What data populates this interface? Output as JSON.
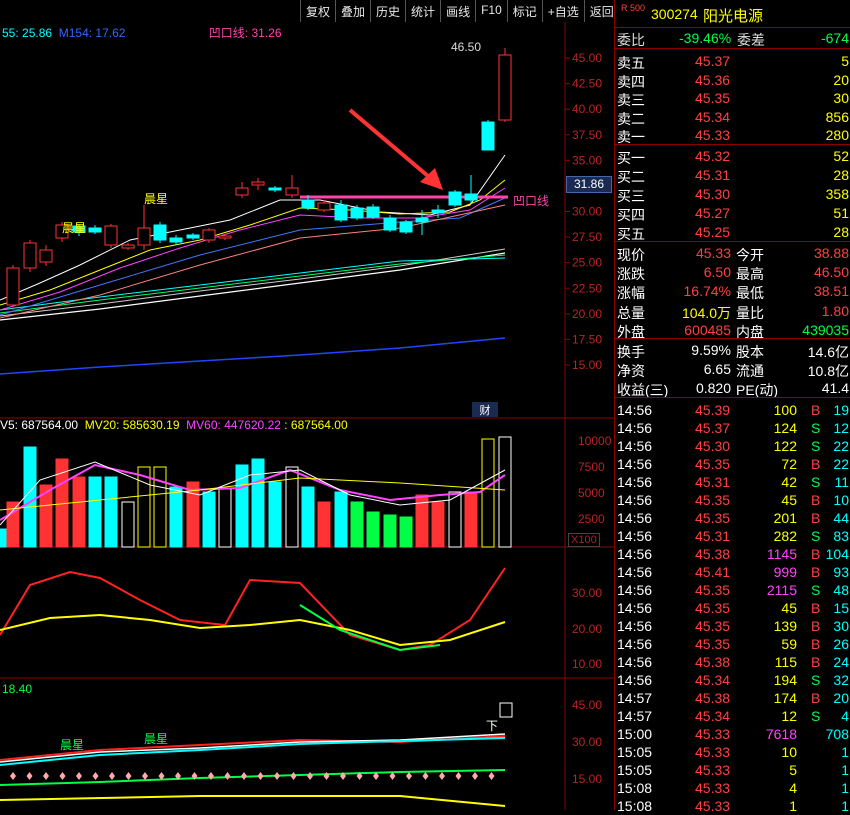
{
  "toolbar": [
    "复权",
    "叠加",
    "历史",
    "统计",
    "画线",
    "F10",
    "标记",
    "+自选",
    "返回"
  ],
  "ma_legend": {
    "ma55": "55: 25.86",
    "ma154": "M154: 17.62",
    "aokou": "凹口线: 31.26"
  },
  "price_axis": [
    "45.00",
    "42.50",
    "40.00",
    "37.50",
    "35.00",
    "32.50",
    "30.00",
    "27.50",
    "25.00",
    "22.50",
    "20.00",
    "17.50",
    "15.00"
  ],
  "current_price_tag": "31.86",
  "max_label": "46.50",
  "pattern_labels": {
    "chenxing": "晨星",
    "aokou_line": "凹口线",
    "cai": "财"
  },
  "volume_legend": {
    "v5": "V5: 687564.00",
    "mv20": "MV20: 585630.19",
    "mv60": "MV60: 447620.22",
    "v": ": 687564.00"
  },
  "volume_axis": [
    "10000",
    "7500",
    "5000",
    "2500"
  ],
  "volume_scale": "X100",
  "ind2_axis": [
    "30.00",
    "20.00",
    "10.00"
  ],
  "ind3_legend": "18.40",
  "ind3_axis": [
    "45.00",
    "30.00",
    "15.00"
  ],
  "ind3_labels": {
    "chenxing": "晨星",
    "xia": "下"
  },
  "stock": {
    "index_tag": "R 500",
    "code": "300274",
    "name": "阳光电源"
  },
  "weibi": {
    "label": "委比",
    "value": "-39.46%",
    "label2": "委差",
    "value2": "-674"
  },
  "asks": [
    {
      "label": "卖五",
      "price": "45.37",
      "vol": "5"
    },
    {
      "label": "卖四",
      "price": "45.36",
      "vol": "20"
    },
    {
      "label": "卖三",
      "price": "45.35",
      "vol": "30"
    },
    {
      "label": "卖二",
      "price": "45.34",
      "vol": "856"
    },
    {
      "label": "卖一",
      "price": "45.33",
      "vol": "280"
    }
  ],
  "bids": [
    {
      "label": "买一",
      "price": "45.32",
      "vol": "52"
    },
    {
      "label": "买二",
      "price": "45.31",
      "vol": "28"
    },
    {
      "label": "买三",
      "price": "45.30",
      "vol": "358"
    },
    {
      "label": "买四",
      "price": "45.27",
      "vol": "51"
    },
    {
      "label": "买五",
      "price": "45.25",
      "vol": "28"
    }
  ],
  "stats": [
    {
      "l1": "现价",
      "v1": "45.33",
      "l2": "今开",
      "v2": "38.88",
      "c1": "red",
      "c2": "red"
    },
    {
      "l1": "涨跌",
      "v1": "6.50",
      "l2": "最高",
      "v2": "46.50",
      "c1": "red",
      "c2": "red"
    },
    {
      "l1": "涨幅",
      "v1": "16.74%",
      "l2": "最低",
      "v2": "38.51",
      "c1": "red",
      "c2": "red"
    },
    {
      "l1": "总量",
      "v1": "104.0万",
      "l2": "量比",
      "v2": "1.80",
      "c1": "yellow",
      "c2": "red"
    },
    {
      "l1": "外盘",
      "v1": "600485",
      "l2": "内盘",
      "v2": "439035",
      "c1": "red",
      "c2": "green"
    }
  ],
  "stats2": [
    {
      "l1": "换手",
      "v1": "9.59%",
      "l2": "股本",
      "v2": "14.6亿"
    },
    {
      "l1": "净资",
      "v1": "6.65",
      "l2": "流通",
      "v2": "10.8亿"
    },
    {
      "l1": "收益(三)",
      "v1": "0.820",
      "l2": "PE(动)",
      "v2": "41.4"
    }
  ],
  "ticks": [
    {
      "t": "14:56",
      "p": "45.39",
      "v": "100",
      "d": "B",
      "n": "19",
      "pc": "red",
      "vc": "yellow"
    },
    {
      "t": "14:56",
      "p": "45.37",
      "v": "124",
      "d": "S",
      "n": "12",
      "pc": "red",
      "vc": "yellow"
    },
    {
      "t": "14:56",
      "p": "45.30",
      "v": "122",
      "d": "S",
      "n": "22",
      "pc": "red",
      "vc": "yellow"
    },
    {
      "t": "14:56",
      "p": "45.35",
      "v": "72",
      "d": "B",
      "n": "22",
      "pc": "red",
      "vc": "yellow"
    },
    {
      "t": "14:56",
      "p": "45.31",
      "v": "42",
      "d": "S",
      "n": "11",
      "pc": "red",
      "vc": "yellow"
    },
    {
      "t": "14:56",
      "p": "45.35",
      "v": "45",
      "d": "B",
      "n": "10",
      "pc": "red",
      "vc": "yellow"
    },
    {
      "t": "14:56",
      "p": "45.35",
      "v": "201",
      "d": "B",
      "n": "44",
      "pc": "red",
      "vc": "yellow"
    },
    {
      "t": "14:56",
      "p": "45.31",
      "v": "282",
      "d": "S",
      "n": "83",
      "pc": "red",
      "vc": "yellow"
    },
    {
      "t": "14:56",
      "p": "45.38",
      "v": "1145",
      "d": "B",
      "n": "104",
      "pc": "red",
      "vc": "magenta"
    },
    {
      "t": "14:56",
      "p": "45.41",
      "v": "999",
      "d": "B",
      "n": "93",
      "pc": "red",
      "vc": "magenta"
    },
    {
      "t": "14:56",
      "p": "45.35",
      "v": "2115",
      "d": "S",
      "n": "48",
      "pc": "red",
      "vc": "magenta"
    },
    {
      "t": "14:56",
      "p": "45.35",
      "v": "45",
      "d": "B",
      "n": "15",
      "pc": "red",
      "vc": "yellow"
    },
    {
      "t": "14:56",
      "p": "45.35",
      "v": "139",
      "d": "B",
      "n": "30",
      "pc": "red",
      "vc": "yellow"
    },
    {
      "t": "14:56",
      "p": "45.35",
      "v": "59",
      "d": "B",
      "n": "26",
      "pc": "red",
      "vc": "yellow"
    },
    {
      "t": "14:56",
      "p": "45.38",
      "v": "115",
      "d": "B",
      "n": "24",
      "pc": "red",
      "vc": "yellow"
    },
    {
      "t": "14:56",
      "p": "45.34",
      "v": "194",
      "d": "S",
      "n": "32",
      "pc": "red",
      "vc": "yellow"
    },
    {
      "t": "14:57",
      "p": "45.38",
      "v": "174",
      "d": "B",
      "n": "20",
      "pc": "red",
      "vc": "yellow"
    },
    {
      "t": "14:57",
      "p": "45.34",
      "v": "12",
      "d": "S",
      "n": "4",
      "pc": "red",
      "vc": "yellow"
    },
    {
      "t": "15:00",
      "p": "45.33",
      "v": "7618",
      "d": "",
      "n": "708",
      "pc": "red",
      "vc": "magenta"
    },
    {
      "t": "15:05",
      "p": "45.33",
      "v": "10",
      "d": "",
      "n": "1",
      "pc": "red",
      "vc": "yellow"
    },
    {
      "t": "15:05",
      "p": "45.33",
      "v": "5",
      "d": "",
      "n": "1",
      "pc": "red",
      "vc": "yellow"
    },
    {
      "t": "15:08",
      "p": "45.33",
      "v": "4",
      "d": "",
      "n": "1",
      "pc": "red",
      "vc": "yellow"
    },
    {
      "t": "15:08",
      "p": "45.33",
      "v": "1",
      "d": "",
      "n": "1",
      "pc": "red",
      "vc": "yellow"
    }
  ],
  "colors": {
    "up": "#ff3333",
    "down": "#00ffff",
    "bg": "#000000",
    "grid": "#8b0000"
  }
}
